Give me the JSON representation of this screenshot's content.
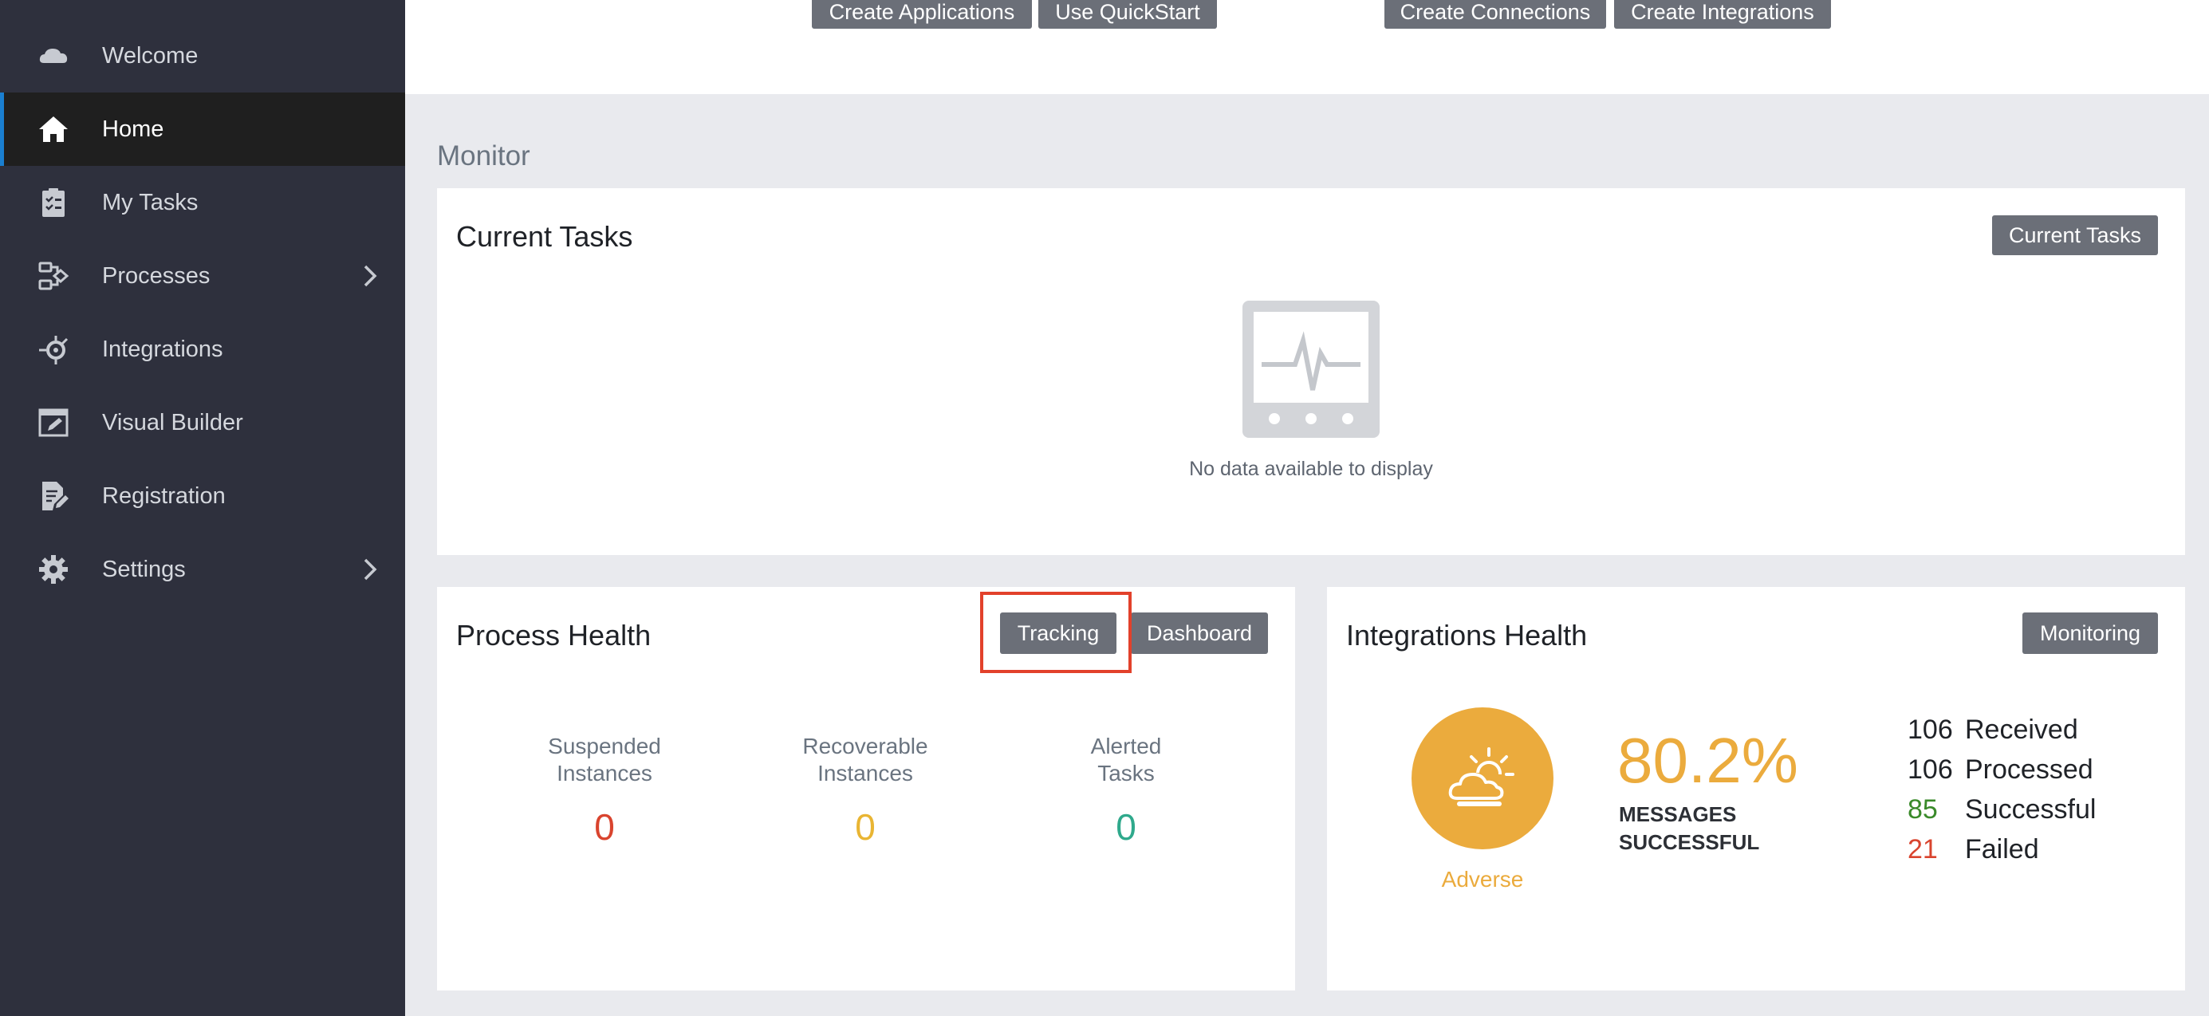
{
  "sidebar": {
    "items": [
      {
        "label": "Welcome",
        "icon": "cloud-icon",
        "active": false
      },
      {
        "label": "Home",
        "icon": "home-icon",
        "active": true
      },
      {
        "label": "My Tasks",
        "icon": "tasks-icon",
        "active": false
      },
      {
        "label": "Processes",
        "icon": "processes-icon",
        "active": false,
        "has_submenu": true
      },
      {
        "label": "Integrations",
        "icon": "integrations-icon",
        "active": false
      },
      {
        "label": "Visual Builder",
        "icon": "visual-builder-icon",
        "active": false
      },
      {
        "label": "Registration",
        "icon": "registration-icon",
        "active": false
      },
      {
        "label": "Settings",
        "icon": "settings-icon",
        "active": false,
        "has_submenu": true
      }
    ]
  },
  "topbar": {
    "create_applications": "Create Applications",
    "use_quickstart": "Use QuickStart",
    "create_connections": "Create Connections",
    "create_integrations": "Create Integrations"
  },
  "monitor": {
    "section_title": "Monitor",
    "current_tasks": {
      "title": "Current Tasks",
      "button": "Current Tasks",
      "empty_text": "No data available to display"
    },
    "process_health": {
      "title": "Process Health",
      "tracking_button": "Tracking",
      "dashboard_button": "Dashboard",
      "metrics": [
        {
          "label_line1": "Suspended",
          "label_line2": "Instances",
          "value": "0",
          "color": "#d9442e"
        },
        {
          "label_line1": "Recoverable",
          "label_line2": "Instances",
          "value": "0",
          "color": "#e9b533"
        },
        {
          "label_line1": "Alerted",
          "label_line2": "Tasks",
          "value": "0",
          "color": "#2fa98c"
        }
      ]
    },
    "integrations_health": {
      "title": "Integrations Health",
      "button": "Monitoring",
      "status": "Adverse",
      "percentage": "80.2%",
      "pct_label_line1": "MESSAGES",
      "pct_label_line2": "SUCCESSFUL",
      "stats": [
        {
          "value": "106",
          "label": "Received",
          "color": "#1f2227"
        },
        {
          "value": "106",
          "label": "Processed",
          "color": "#1f2227"
        },
        {
          "value": "85",
          "label": "Successful",
          "color": "#3a8a2a"
        },
        {
          "value": "21",
          "label": "Failed",
          "color": "#d9442e"
        }
      ]
    }
  },
  "colors": {
    "sidebar_bg": "#2e303d",
    "active_bg": "#1f1f1f",
    "accent": "#1a7fd0",
    "button_bg": "#6b6f78",
    "warning": "#ebab3d",
    "highlight": "#e2412b"
  }
}
